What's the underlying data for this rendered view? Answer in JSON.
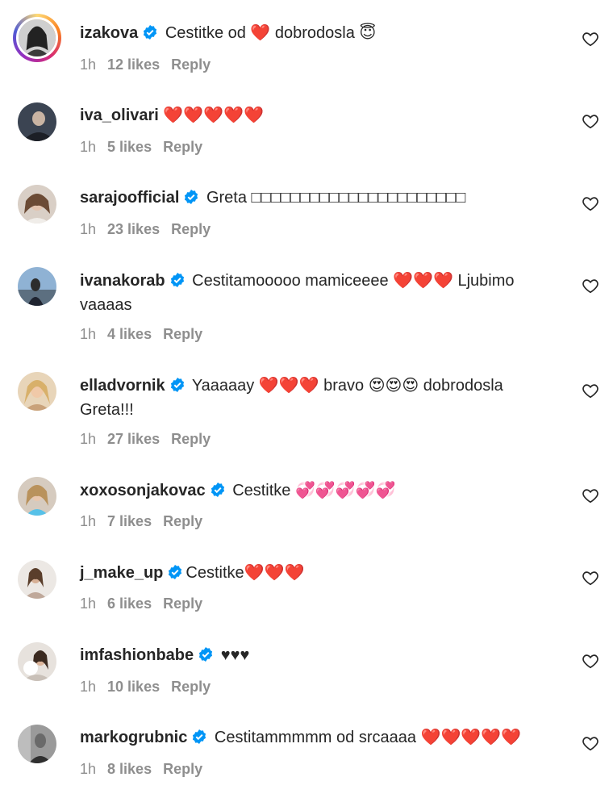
{
  "comments": [
    {
      "username": "izakova",
      "verified": true,
      "text": "Cestitke od ❤️ dobrodosla 😇",
      "time": "1h",
      "likes": "12 likes",
      "reply": "Reply"
    },
    {
      "username": "iva_olivari",
      "verified": false,
      "text": "❤️❤️❤️❤️❤️",
      "time": "1h",
      "likes": "5 likes",
      "reply": "Reply"
    },
    {
      "username": "sarajoofficial",
      "verified": true,
      "text": "Greta □□□□□□□□□□□□□□□□□□□□□□",
      "time": "1h",
      "likes": "23 likes",
      "reply": "Reply"
    },
    {
      "username": "ivanakorab",
      "verified": true,
      "text": "Cestitamooooo mamiceeee ❤️❤️❤️ Ljubimo vaaaas",
      "time": "1h",
      "likes": "4 likes",
      "reply": "Reply"
    },
    {
      "username": "elladvornik",
      "verified": true,
      "text": "Yaaaaay ❤️❤️❤️ bravo 😍😍😍 dobrodosla Greta!!!",
      "time": "1h",
      "likes": "27 likes",
      "reply": "Reply"
    },
    {
      "username": "xoxosonjakovac",
      "verified": true,
      "text": "Cestitke 💞💞💞💞💞",
      "time": "1h",
      "likes": "7 likes",
      "reply": "Reply"
    },
    {
      "username": "j_make_up",
      "verified": true,
      "text": "Cestitke❤️❤️❤️",
      "time": "1h",
      "likes": "6 likes",
      "reply": "Reply"
    },
    {
      "username": "imfashionbabe",
      "verified": true,
      "text": "♥♥♥",
      "time": "1h",
      "likes": "10 likes",
      "reply": "Reply"
    },
    {
      "username": "markogrubnic",
      "verified": true,
      "text": "Cestitammmmm od srcaaaa ❤️❤️❤️❤️❤️",
      "time": "1h",
      "likes": "8 likes",
      "reply": "Reply"
    }
  ],
  "icons": {
    "verified": "verified-badge-icon",
    "like": "heart-outline-icon"
  },
  "colors": {
    "verified": "#0095f6",
    "meta": "#8e8e8e",
    "text": "#262626"
  }
}
